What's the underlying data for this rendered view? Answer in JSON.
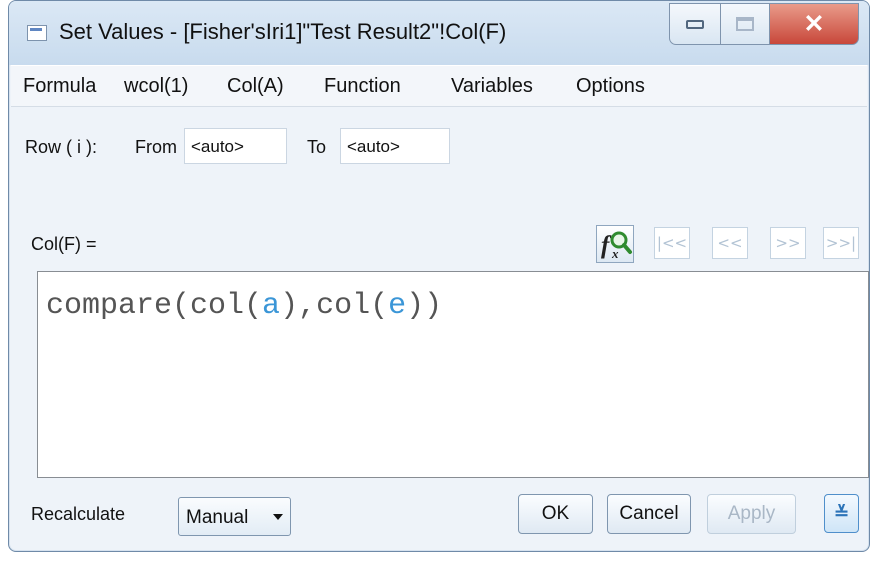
{
  "window": {
    "title": "Set Values - [Fisher'sIri1]\"Test Result2\"!Col(F)",
    "minimize_icon": "minimize-icon",
    "maximize_icon": "maximize-icon",
    "close_label": "✕"
  },
  "menu": [
    {
      "label": "Formula"
    },
    {
      "label": "wcol(1)"
    },
    {
      "label": "Col(A)"
    },
    {
      "label": "Function"
    },
    {
      "label": "Variables"
    },
    {
      "label": "Options"
    }
  ],
  "row_range": {
    "label": "Row ( i ):",
    "from_label": "From",
    "from_value": "<auto>",
    "to_label": "To",
    "to_value": "<auto>"
  },
  "column": {
    "label": "Col(F) =",
    "fx_icon": "function-search-icon",
    "nav": [
      "|<<",
      "<<",
      ">>",
      ">>|"
    ]
  },
  "formula": {
    "prefix": "compare(col(",
    "arg1": "a",
    "mid": "),col(",
    "arg2": "e",
    "suffix": "))"
  },
  "footer": {
    "recalculate_label": "Recalculate",
    "recalculate_value": "Manual",
    "ok_label": "OK",
    "cancel_label": "Cancel",
    "apply_label": "Apply",
    "expand_label": "≚"
  },
  "colors": {
    "accent": "#3b96d7",
    "close": "#c8473a"
  }
}
